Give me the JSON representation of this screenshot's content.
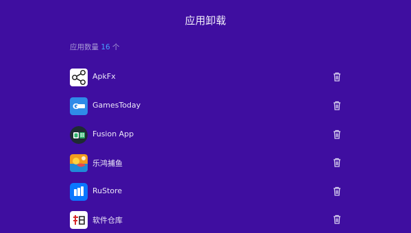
{
  "header": {
    "title": "应用卸载"
  },
  "summary": {
    "label": "应用数量 ",
    "count": "16",
    "unit": " 个"
  },
  "apps": [
    {
      "name": "ApkFx",
      "icon": "apkfx-share-icon"
    },
    {
      "name": "GamesToday",
      "icon": "gamestoday-icon"
    },
    {
      "name": "Fusion App",
      "icon": "fusion-app-icon"
    },
    {
      "name": "乐鸿捕鱼",
      "icon": "fishing-game-icon"
    },
    {
      "name": "RuStore",
      "icon": "rustore-icon"
    },
    {
      "name": "软件仓库",
      "icon": "software-warehouse-icon"
    }
  ],
  "colors": {
    "background": "#3F0EA0",
    "accent": "#47A0FF"
  }
}
